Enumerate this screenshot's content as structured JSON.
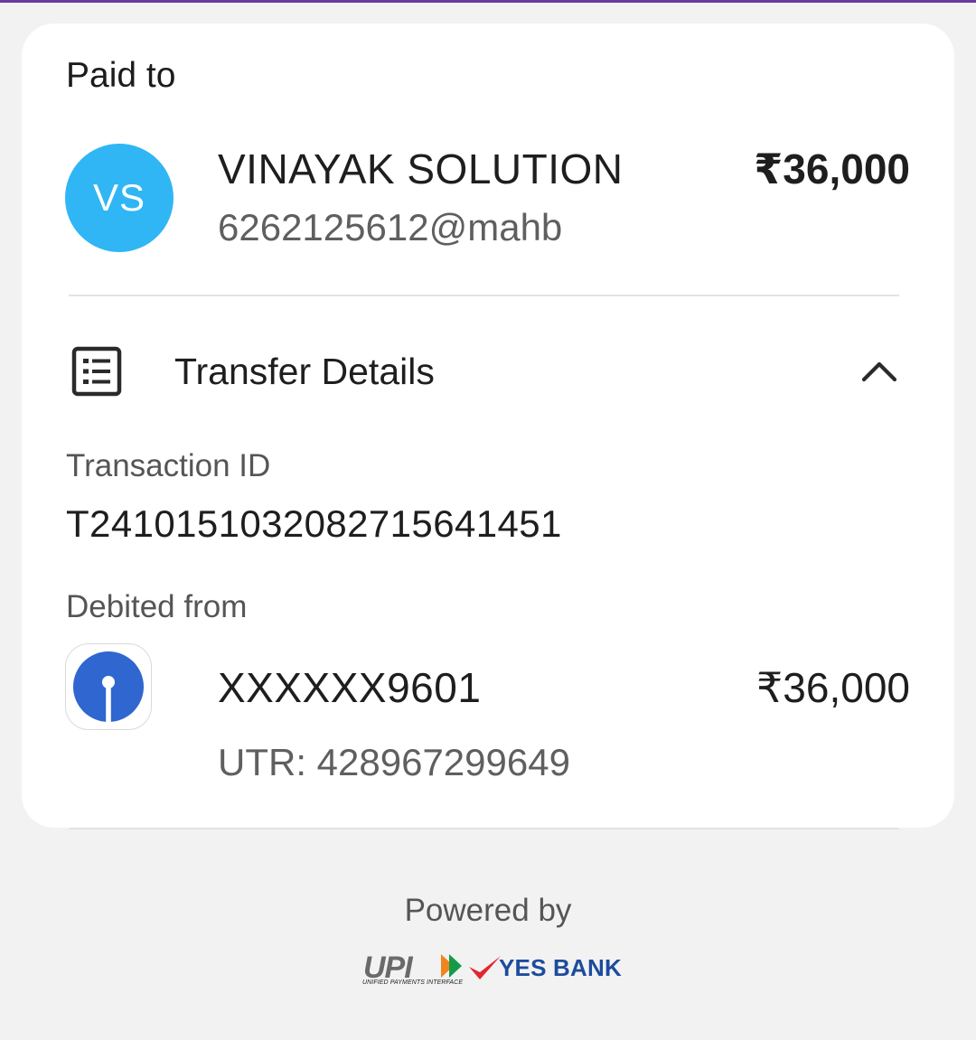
{
  "header": {
    "accent_color": "#6b3aa0"
  },
  "paid_to": {
    "label": "Paid to",
    "avatar_initials": "VS",
    "avatar_color": "#30b6f4",
    "name": "VINAYAK SOLUTION",
    "vpa": "6262125612@mahb",
    "amount": "₹36,000"
  },
  "transfer_details": {
    "title": "Transfer Details",
    "icon": "receipt-list-icon",
    "toggle_icon": "chevron-up-icon",
    "transaction_id_label": "Transaction ID",
    "transaction_id": "T2410151032082715641451",
    "debited_from_label": "Debited from",
    "bank_icon": "sbi-bank-logo",
    "bank_logo_color": "#2f66d0",
    "account_number": "XXXXXX9601",
    "debit_amount": "₹36,000",
    "utr": "UTR: 428967299649"
  },
  "footer": {
    "powered_by": "Powered by",
    "upi_logo_text": "UPI",
    "upi_tagline": "UNIFIED PAYMENTS INTERFACE",
    "partner_bank": "YES BANK",
    "partner_color": "#1c4c9c",
    "partner_tick_color": "#e3262f"
  }
}
